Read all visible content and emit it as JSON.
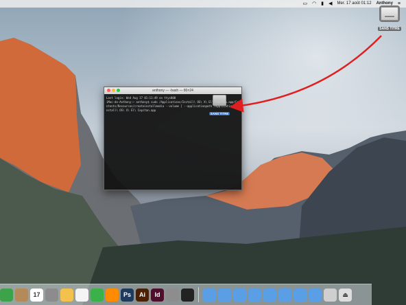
{
  "menubar": {
    "date_time": "Mer. 17 août  01:12",
    "user": "Anthony",
    "icons": [
      "airplay-icon",
      "wifi-icon",
      "battery-icon",
      "volume-icon",
      "list-icon"
    ]
  },
  "desktop": {
    "drive_label": "SANS TITRE"
  },
  "terminal": {
    "title": "anthony — -bash — 80×24",
    "lines": [
      "Last login: Wed Aug 17 01:11:49 on ttys000",
      "iMac-de-Anthony:~ anthony$ sudo /Applications/Install\\ OS\\ X\\ El\\ Capitan.app/Co",
      "ntents/Resources/createinstallmedia --volume [ --applicationpath /Applications/I",
      "nstall\\ OS\\ X\\ El\\ Capitan.app"
    ],
    "drag_label": "SANS TITRE"
  },
  "dock": {
    "items": [
      {
        "name": "facetime-icon",
        "label": "",
        "color": "#3da34a"
      },
      {
        "name": "contacts-icon",
        "label": "",
        "color": "#b58a5a"
      },
      {
        "name": "calendar-icon",
        "label": "17",
        "color": "#ffffff"
      },
      {
        "name": "preview-icon",
        "label": "",
        "color": "#8c8c8c"
      },
      {
        "name": "photos-icon",
        "label": "",
        "color": "#f2c14e"
      },
      {
        "name": "textedit-icon",
        "label": "",
        "color": "#f4f4f4"
      },
      {
        "name": "numbers-icon",
        "label": "",
        "color": "#3bb14a"
      },
      {
        "name": "vlc-icon",
        "label": "",
        "color": "#ff8c00"
      },
      {
        "name": "photoshop-icon",
        "label": "Ps",
        "color": "#1f3b5c"
      },
      {
        "name": "illustrator-icon",
        "label": "Ai",
        "color": "#4a2006"
      },
      {
        "name": "indesign-icon",
        "label": "Id",
        "color": "#4d0f2c"
      },
      {
        "name": "system-preferences-icon",
        "label": "",
        "color": "#8d8d8d"
      },
      {
        "name": "terminal-icon",
        "label": "",
        "color": "#222222"
      },
      {
        "name": "applications-folder-icon",
        "label": "",
        "color": "#5a9fe6"
      },
      {
        "name": "documents-folder-icon",
        "label": "",
        "color": "#5a9fe6"
      },
      {
        "name": "downloads-folder-icon",
        "label": "",
        "color": "#5a9fe6"
      },
      {
        "name": "folder-icon",
        "label": "",
        "color": "#5a9fe6"
      },
      {
        "name": "folder-icon",
        "label": "",
        "color": "#5a9fe6"
      },
      {
        "name": "folder-icon",
        "label": "",
        "color": "#5a9fe6"
      },
      {
        "name": "folder-icon",
        "label": "",
        "color": "#5a9fe6"
      },
      {
        "name": "folder-icon",
        "label": "",
        "color": "#5a9fe6"
      },
      {
        "name": "drive-icon",
        "label": "",
        "color": "#cfcfcf"
      },
      {
        "name": "eject-icon",
        "label": "⏏",
        "color": "#dddddd"
      }
    ]
  },
  "annotation": {
    "arrow_color": "#e02020"
  }
}
